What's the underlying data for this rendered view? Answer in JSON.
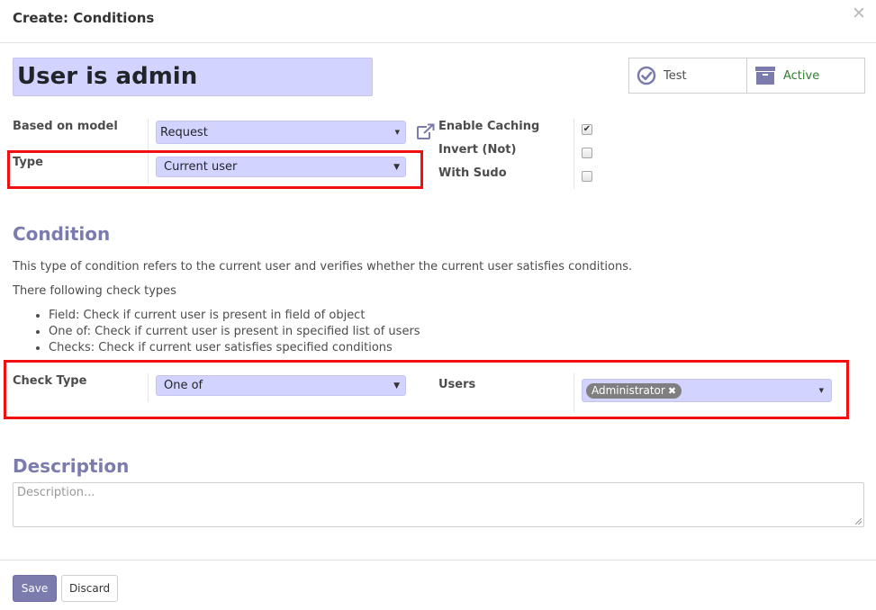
{
  "dialog": {
    "title": "Create: Conditions"
  },
  "record": {
    "name": "User is admin"
  },
  "button_box": {
    "test_label": "Test",
    "active_label": "Active"
  },
  "fields": {
    "model_label": "Based on model",
    "model_value": "Request",
    "type_label": "Type",
    "type_value": "Current user",
    "enable_caching_label": "Enable Caching",
    "enable_caching_checked": true,
    "invert_label": "Invert (Not)",
    "invert_checked": false,
    "with_sudo_label": "With Sudo",
    "with_sudo_checked": false
  },
  "condition": {
    "title": "Condition",
    "intro": "This type of condition refers to the current user and verifies whether the current user satisfies conditions.",
    "types_intro": "There following check types",
    "check_types": [
      "Field: Check if current user is present in field of object",
      "One of: Check if current user is present in specified list of users",
      "Checks: Check if current user satisfies specified conditions"
    ],
    "check_type_label": "Check Type",
    "check_type_value": "One of",
    "users_label": "Users",
    "users_tags": [
      "Administrator"
    ]
  },
  "description": {
    "title": "Description",
    "placeholder": "Description..."
  },
  "footer": {
    "save_label": "Save",
    "discard_label": "Discard"
  },
  "colors": {
    "accent": "#7c7bad",
    "field_bg": "#d3d3ff",
    "highlight": "#f30f0f",
    "active_text": "#2f8030"
  },
  "icons": {
    "close": "close-icon",
    "test": "check-circle-icon",
    "active": "archive-icon",
    "external_link": "external-link-icon",
    "tag_remove": "remove-tag-icon"
  }
}
